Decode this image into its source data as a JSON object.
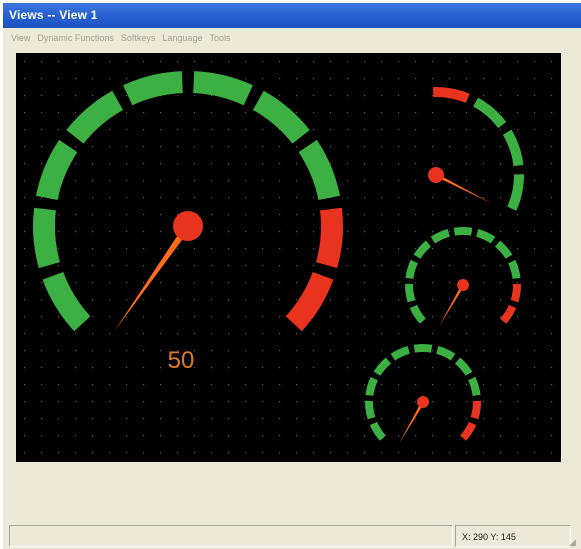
{
  "window": {
    "title": "Views -- View 1"
  },
  "menu": {
    "items": [
      "View",
      "Dynamic Functions",
      "Softkeys",
      "Language",
      "Tools"
    ]
  },
  "colors": {
    "panel_background": "#000000",
    "gauge_green": "#3cb043",
    "gauge_red": "#e8341f",
    "needle": "#ff6b1a",
    "readout": "#e07a1e",
    "dot_grid": "#5a5a5a"
  },
  "gauges": [
    {
      "id": "main-gauge",
      "value": 50,
      "readout": "50",
      "arc": "full",
      "green_segments": 8,
      "red_segments": 2
    },
    {
      "id": "small-gauge-1",
      "arc": "partial",
      "green_segments": 3,
      "red_segments": 1
    },
    {
      "id": "small-gauge-2",
      "arc": "full",
      "green_segments": 9,
      "red_segments": 2
    },
    {
      "id": "small-gauge-3",
      "arc": "full",
      "green_segments": 9,
      "red_segments": 2
    }
  ],
  "status": {
    "coords": "X: 290 Y: 145"
  }
}
